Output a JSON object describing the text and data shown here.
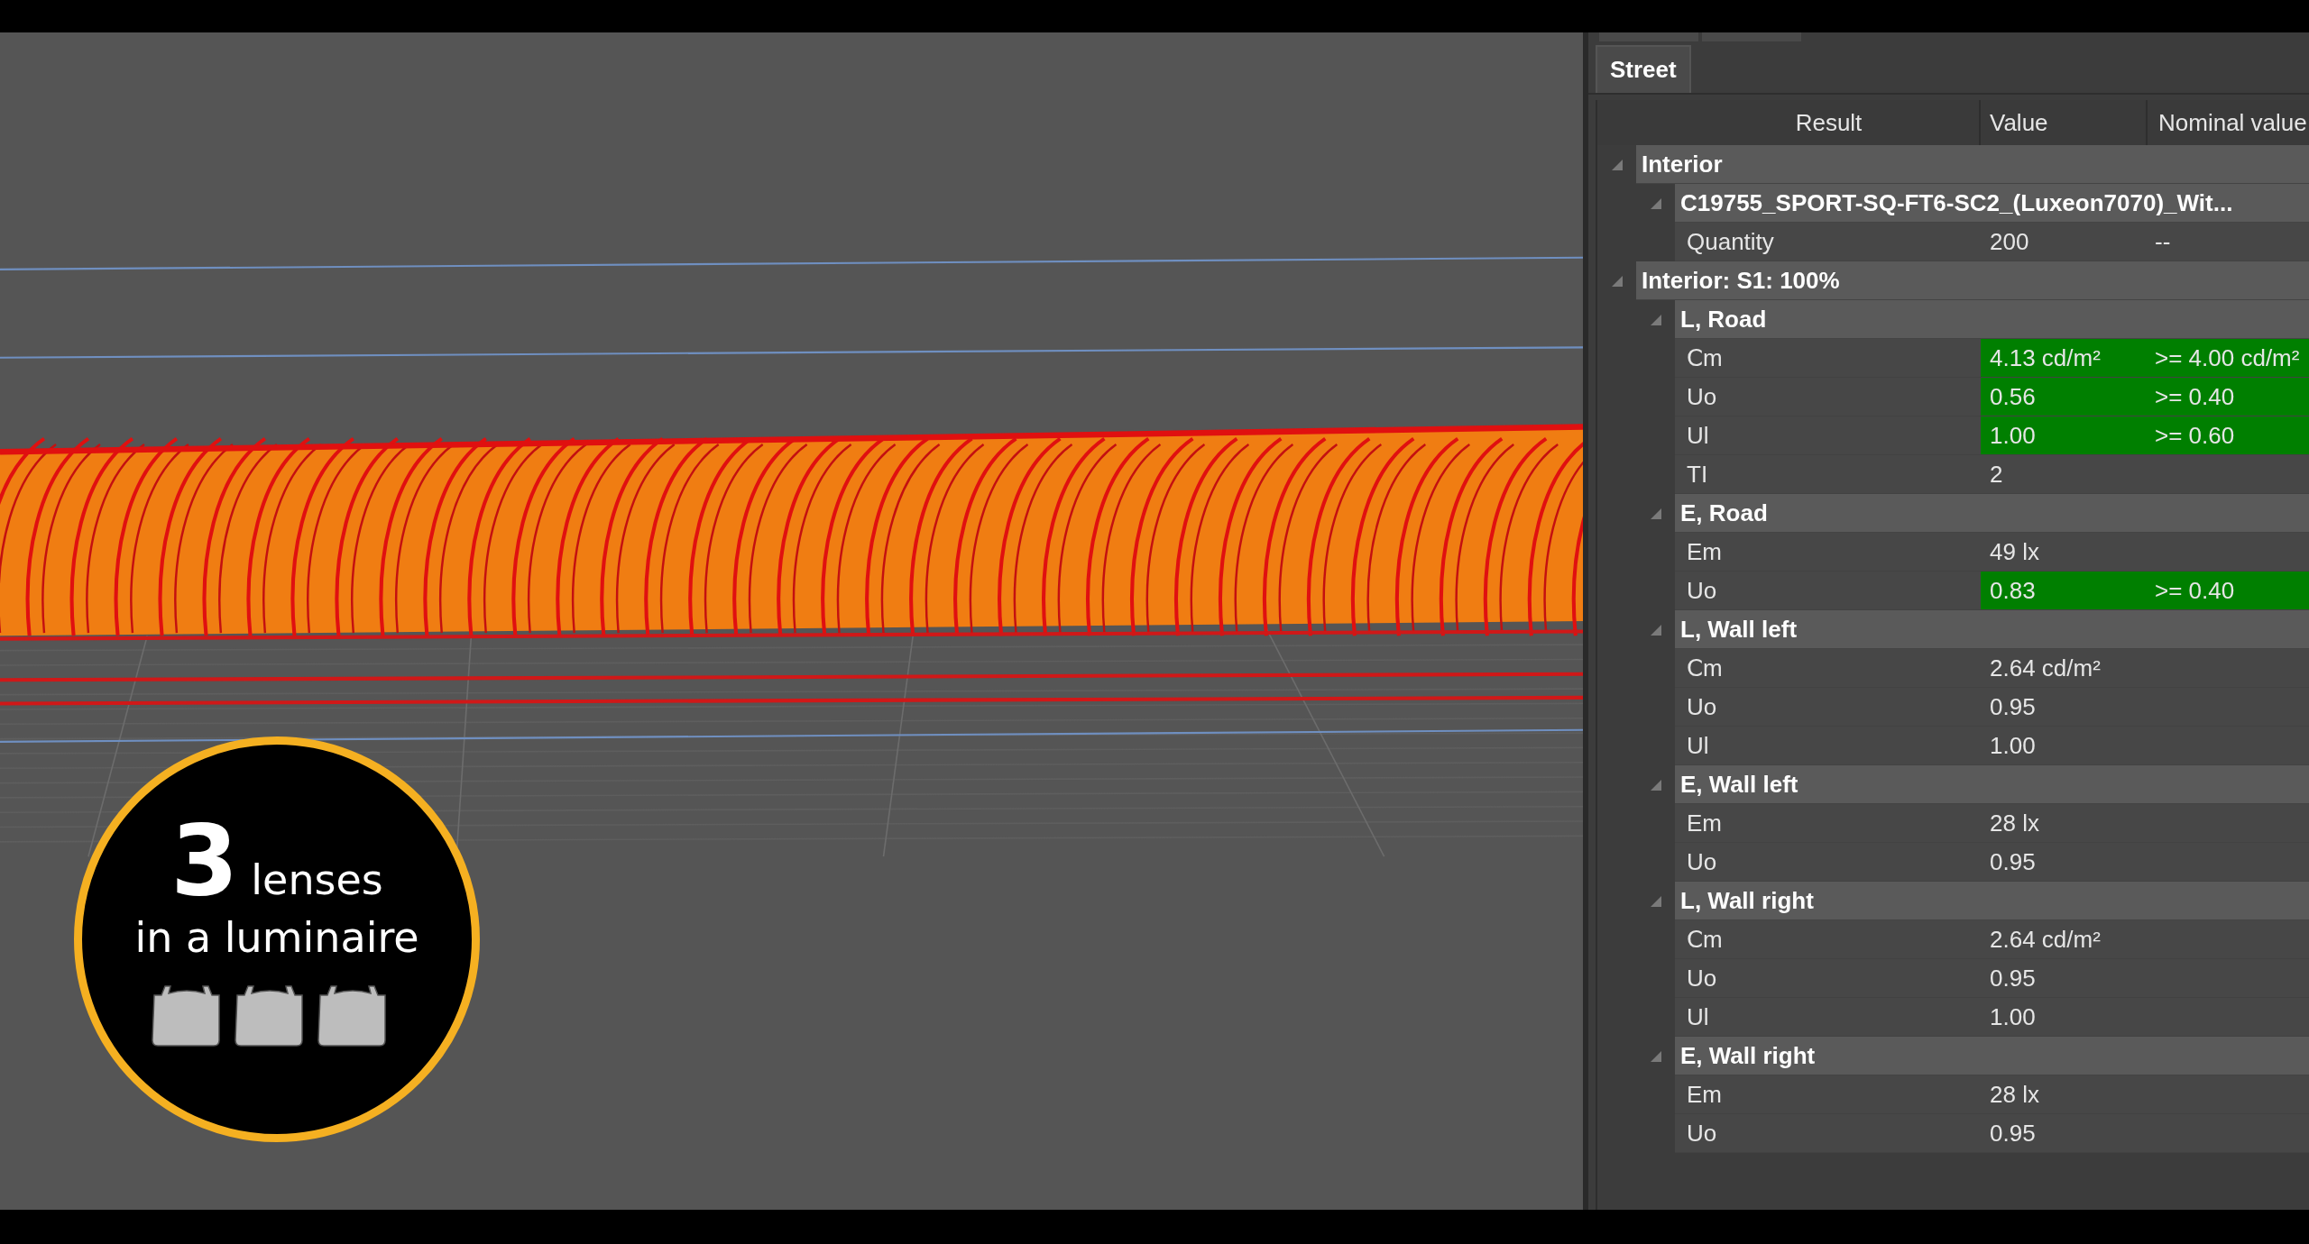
{
  "badge": {
    "number": "3",
    "word": "lenses",
    "line2": "in a luminaire"
  },
  "tabs": [
    {
      "label": "Street",
      "selected": true
    }
  ],
  "columns": [
    "Result",
    "Value",
    "Nominal value"
  ],
  "tree": [
    {
      "label": "Interior",
      "expanded": true,
      "children": [
        {
          "label": "C19755_SPORT-SQ-FT6-SC2_(Luxeon7070)_Wit...",
          "expanded": true,
          "children": [
            {
              "label": "Quantity",
              "value": "200",
              "nominal": "--",
              "passed": false
            }
          ]
        }
      ]
    },
    {
      "label": "Interior: S1: 100%",
      "expanded": true,
      "children": [
        {
          "label": "L, Road",
          "expanded": true,
          "children": [
            {
              "label": "Ⅽm",
              "value": "4.13 cd/m²",
              "nominal": ">= 4.00 cd/m²",
              "passed": true
            },
            {
              "label": "Uo",
              "value": "0.56",
              "nominal": ">= 0.40",
              "passed": true
            },
            {
              "label": "Ul",
              "value": "1.00",
              "nominal": ">= 0.60",
              "passed": true
            },
            {
              "label": "TI",
              "value": "2",
              "passed": false
            }
          ]
        },
        {
          "label": "E, Road",
          "expanded": true,
          "children": [
            {
              "label": "Em",
              "value": "49 lx",
              "passed": false
            },
            {
              "label": "Uo",
              "value": "0.83",
              "nominal": ">= 0.40",
              "passed": true
            }
          ]
        },
        {
          "label": "L, Wall left",
          "expanded": true,
          "children": [
            {
              "label": "Ⅽm",
              "value": "2.64 cd/m²",
              "passed": false
            },
            {
              "label": "Uo",
              "value": "0.95",
              "passed": false
            },
            {
              "label": "Ul",
              "value": "1.00",
              "passed": false
            }
          ]
        },
        {
          "label": "E, Wall left",
          "expanded": true,
          "children": [
            {
              "label": "Em",
              "value": "28 lx",
              "passed": false
            },
            {
              "label": "Uo",
              "value": "0.95",
              "passed": false
            }
          ]
        },
        {
          "label": "L, Wall right",
          "expanded": true,
          "children": [
            {
              "label": "Ⅽm",
              "value": "2.64 cd/m²",
              "passed": false
            },
            {
              "label": "Uo",
              "value": "0.95",
              "passed": false
            },
            {
              "label": "Ul",
              "value": "1.00",
              "passed": false
            }
          ]
        },
        {
          "label": "E, Wall right",
          "expanded": true,
          "children": [
            {
              "label": "Em",
              "value": "28 lx",
              "passed": false
            },
            {
              "label": "Uo",
              "value": "0.95",
              "passed": false
            }
          ]
        }
      ]
    }
  ]
}
